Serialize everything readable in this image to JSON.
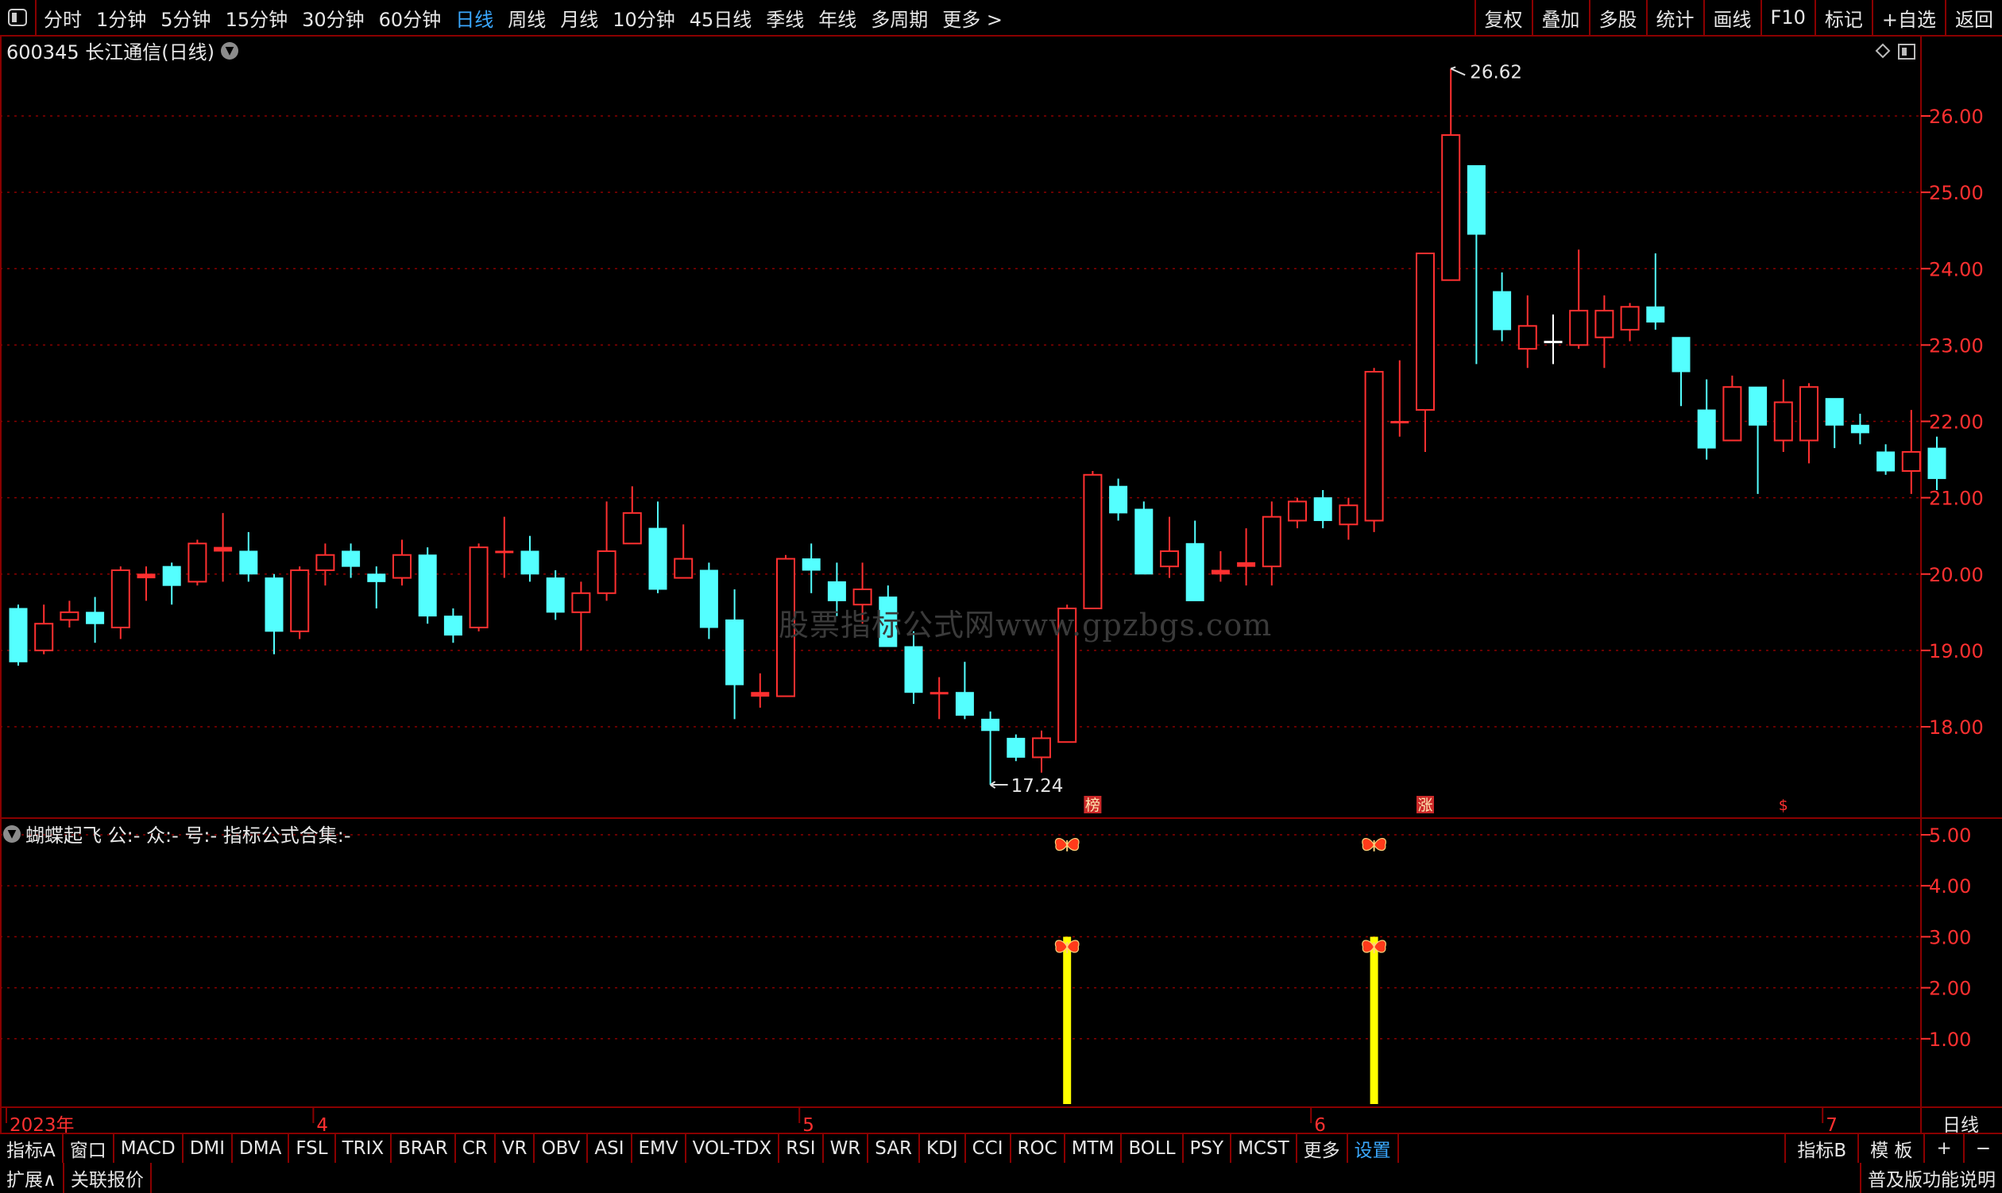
{
  "toolbar": {
    "periods": [
      "分时",
      "1分钟",
      "5分钟",
      "15分钟",
      "30分钟",
      "60分钟",
      "日线",
      "周线",
      "月线",
      "10分钟",
      "45日线",
      "季线",
      "年线",
      "多周期",
      "更多 >"
    ],
    "active_index": 6,
    "right_buttons": [
      "复权",
      "叠加",
      "多股",
      "统计",
      "画线",
      "F10",
      "标记",
      "+自选",
      "返回"
    ]
  },
  "chart_title": "600345 长江通信(日线)",
  "indicator_title": "蝴蝶起飞 公:- 众:- 号:- 指标公式合集:-",
  "watermark": "股票指标公式网www.gpzbgs.com",
  "bottom_tabs": [
    "指标A",
    "窗口",
    "MACD",
    "DMI",
    "DMA",
    "FSL",
    "TRIX",
    "BRAR",
    "CR",
    "VR",
    "OBV",
    "ASI",
    "EMV",
    "VOL-TDX",
    "RSI",
    "WR",
    "SAR",
    "KDJ",
    "CCI",
    "ROC",
    "MTM",
    "BOLL",
    "PSY",
    "MCST",
    "更多",
    "设置"
  ],
  "bottom_active": "设置",
  "bottom_right": [
    "指标B",
    "模 板",
    "+",
    "−"
  ],
  "period_label": "日线",
  "status": {
    "left": [
      "扩展∧",
      "关联报价"
    ],
    "right": "普及版功能说明"
  },
  "colors": {
    "up": "#ff3030",
    "down": "#54ffff",
    "grid": "#8a0000",
    "axis_text": "#ff3030",
    "highlight": "#ffff00"
  },
  "chart_data": {
    "type": "candlestick",
    "y_range": [
      17.0,
      26.9
    ],
    "y_ticks": [
      "26.00",
      "25.00",
      "24.00",
      "23.00",
      "22.00",
      "21.00",
      "20.00",
      "19.00",
      "18.00"
    ],
    "candles": [
      [
        19.55,
        18.85,
        19.6,
        18.8
      ],
      [
        19.0,
        19.35,
        19.6,
        18.95
      ],
      [
        19.4,
        19.5,
        19.65,
        19.3
      ],
      [
        19.5,
        19.35,
        19.7,
        19.1
      ],
      [
        19.3,
        20.05,
        20.1,
        19.15
      ],
      [
        19.95,
        20.0,
        20.1,
        19.65
      ],
      [
        20.1,
        19.85,
        20.15,
        19.6
      ],
      [
        19.9,
        20.4,
        20.45,
        19.85
      ],
      [
        20.3,
        20.35,
        20.8,
        19.9
      ],
      [
        20.3,
        20.0,
        20.55,
        19.9
      ],
      [
        19.95,
        19.25,
        20.0,
        18.95
      ],
      [
        19.25,
        20.05,
        20.1,
        19.15
      ],
      [
        20.05,
        20.25,
        20.4,
        19.85
      ],
      [
        20.3,
        20.1,
        20.4,
        19.95
      ],
      [
        20.0,
        19.9,
        20.1,
        19.55
      ],
      [
        19.95,
        20.25,
        20.45,
        19.85
      ],
      [
        20.25,
        19.45,
        20.35,
        19.35
      ],
      [
        19.45,
        19.2,
        19.55,
        19.1
      ],
      [
        19.3,
        20.35,
        20.4,
        19.25
      ],
      [
        20.3,
        20.3,
        20.75,
        19.95
      ],
      [
        20.3,
        20.0,
        20.5,
        19.9
      ],
      [
        19.95,
        19.5,
        20.05,
        19.4
      ],
      [
        19.5,
        19.75,
        19.9,
        19.0
      ],
      [
        19.75,
        20.3,
        20.95,
        19.65
      ],
      [
        20.4,
        20.8,
        21.15,
        20.4
      ],
      [
        20.6,
        19.8,
        20.95,
        19.75
      ],
      [
        19.95,
        20.2,
        20.65,
        19.95
      ],
      [
        20.05,
        19.3,
        20.15,
        19.15
      ],
      [
        19.4,
        18.55,
        19.8,
        18.1
      ],
      [
        18.45,
        18.4,
        18.7,
        18.25
      ],
      [
        18.4,
        20.2,
        20.25,
        18.4
      ],
      [
        20.2,
        20.05,
        20.4,
        19.75
      ],
      [
        19.9,
        19.65,
        20.15,
        19.45
      ],
      [
        19.6,
        19.8,
        20.15,
        19.35
      ],
      [
        19.7,
        19.05,
        19.85,
        19.05
      ],
      [
        19.05,
        18.45,
        19.25,
        18.3
      ],
      [
        18.45,
        18.45,
        18.65,
        18.1
      ],
      [
        18.45,
        18.15,
        18.85,
        18.1
      ],
      [
        18.1,
        17.95,
        18.2,
        17.24
      ],
      [
        17.85,
        17.6,
        17.9,
        17.55
      ],
      [
        17.6,
        17.85,
        17.95,
        17.4
      ],
      [
        17.8,
        19.55,
        19.6,
        17.8
      ],
      [
        19.55,
        21.3,
        21.35,
        19.55
      ],
      [
        21.15,
        20.8,
        21.25,
        20.7
      ],
      [
        20.85,
        20.0,
        20.95,
        20.0
      ],
      [
        20.1,
        20.3,
        20.75,
        19.95
      ],
      [
        20.4,
        19.65,
        20.7,
        19.65
      ],
      [
        20.0,
        20.05,
        20.3,
        19.9
      ],
      [
        20.1,
        20.15,
        20.6,
        19.85
      ],
      [
        20.1,
        20.75,
        20.95,
        19.85
      ],
      [
        20.7,
        20.95,
        21.0,
        20.6
      ],
      [
        21.0,
        20.7,
        21.1,
        20.6
      ],
      [
        20.65,
        20.9,
        21.0,
        20.45
      ],
      [
        20.7,
        22.65,
        22.7,
        20.55
      ],
      [
        22.0,
        22.0,
        22.8,
        21.8
      ],
      [
        22.15,
        24.2,
        24.2,
        21.6
      ],
      [
        23.85,
        25.75,
        26.62,
        23.9
      ],
      [
        25.35,
        24.45,
        25.3,
        22.75
      ],
      [
        23.7,
        23.2,
        23.95,
        23.05
      ],
      [
        22.95,
        23.25,
        23.65,
        22.7
      ],
      [
        23.05,
        23.05,
        23.4,
        22.75
      ],
      [
        23.0,
        23.45,
        24.25,
        22.95
      ],
      [
        23.1,
        23.45,
        23.65,
        22.7
      ],
      [
        23.2,
        23.5,
        23.55,
        23.05
      ],
      [
        23.5,
        23.3,
        24.2,
        23.2
      ],
      [
        23.1,
        22.65,
        23.1,
        22.2
      ],
      [
        22.15,
        21.65,
        22.55,
        21.5
      ],
      [
        21.75,
        22.45,
        22.6,
        21.75
      ],
      [
        22.45,
        21.95,
        22.45,
        21.05
      ],
      [
        21.75,
        22.25,
        22.55,
        21.6
      ],
      [
        21.75,
        22.45,
        22.5,
        21.45
      ],
      [
        22.3,
        21.95,
        22.3,
        21.65
      ],
      [
        21.95,
        21.85,
        22.1,
        21.7
      ],
      [
        21.6,
        21.35,
        21.7,
        21.3
      ],
      [
        21.35,
        21.6,
        22.15,
        21.05
      ],
      [
        21.65,
        21.25,
        21.8,
        21.1
      ]
    ],
    "x_labels": [
      {
        "index": 0,
        "text": "2023年"
      },
      {
        "index": 12,
        "text": "4"
      },
      {
        "index": 31,
        "text": "5"
      },
      {
        "index": 51,
        "text": "6"
      },
      {
        "index": 71,
        "text": "7"
      }
    ],
    "annotations": {
      "high": {
        "index": 56,
        "value": "26.62"
      },
      "low": {
        "index": 38,
        "value": "17.24"
      },
      "events": [
        {
          "index": 42,
          "text": "榜"
        },
        {
          "index": 55,
          "text": "涨"
        },
        {
          "index": 69,
          "text": "$"
        }
      ]
    },
    "indicator": {
      "y_range": [
        0,
        6.0
      ],
      "y_ticks": [
        "5.00",
        "4.00",
        "3.00",
        "2.00",
        "1.00"
      ],
      "signals": [
        {
          "index": 41,
          "top_marker": 4.8,
          "bar": 3.0,
          "bar_marker": 2.8
        },
        {
          "index": 53,
          "top_marker": 4.8,
          "bar": 3.0,
          "bar_marker": 2.8
        }
      ]
    }
  }
}
